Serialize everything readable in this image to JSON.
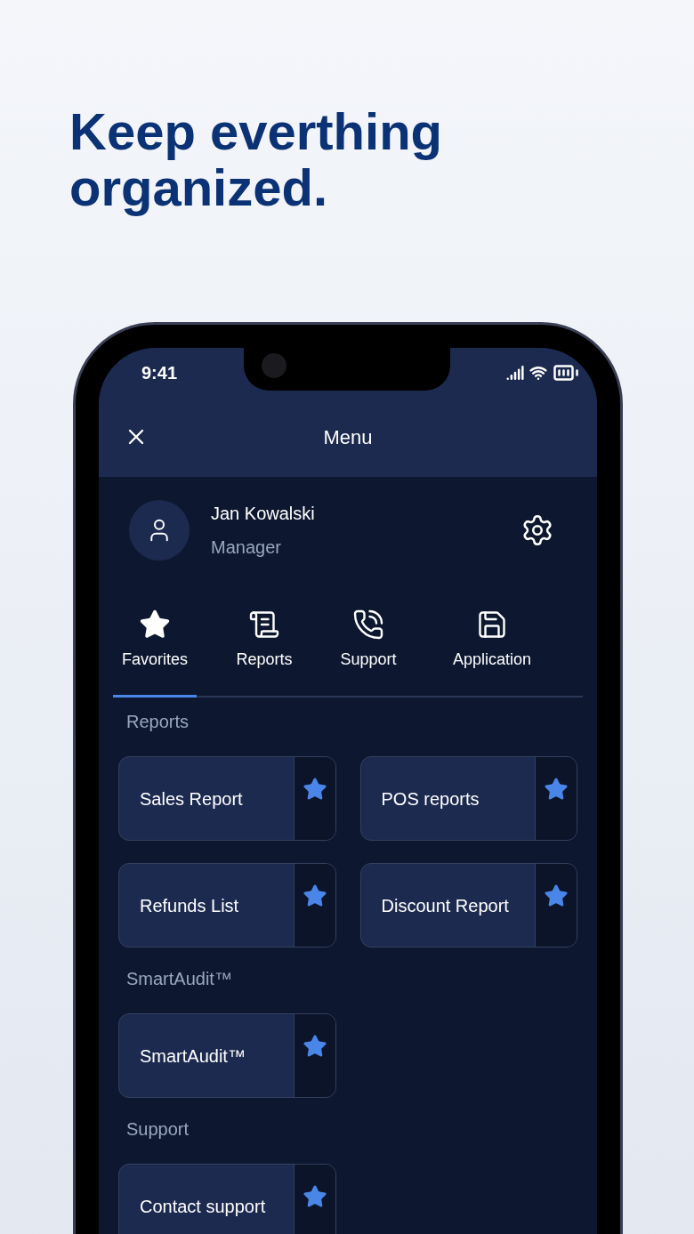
{
  "headline": "Keep everthing organized.",
  "status_bar": {
    "time": "9:41"
  },
  "header": {
    "title": "Menu"
  },
  "profile": {
    "name": "Jan Kowalski",
    "role": "Manager"
  },
  "tabs": [
    {
      "label": "Favorites",
      "selected": true
    },
    {
      "label": "Reports",
      "selected": false
    },
    {
      "label": "Support",
      "selected": false
    },
    {
      "label": "Application",
      "selected": false
    }
  ],
  "sections": [
    {
      "title": "Reports",
      "items": [
        {
          "label": "Sales Report",
          "favorite": true
        },
        {
          "label": "POS reports",
          "favorite": true
        },
        {
          "label": "Refunds List",
          "favorite": true
        },
        {
          "label": "Discount Report",
          "favorite": true
        }
      ]
    },
    {
      "title": "SmartAudit™",
      "items": [
        {
          "label": "SmartAudit™",
          "favorite": true
        }
      ]
    },
    {
      "title": "Support",
      "items": [
        {
          "label": "Contact support",
          "favorite": true
        }
      ]
    }
  ]
}
